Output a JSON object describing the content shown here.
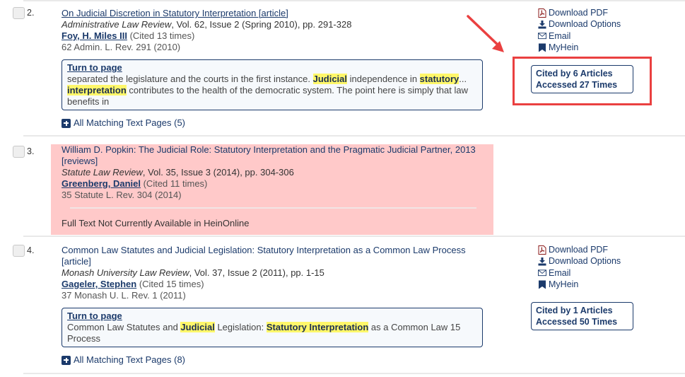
{
  "results": [
    {
      "index": "2.",
      "title": "On Judicial Discretion in Statutory Interpretation [article]",
      "journal_name": "Administrative Law Review",
      "journal_rest": ", Vol. 62, Issue 2 (Spring 2010), pp. 291-328",
      "author": "Foy, H. Miles III",
      "author_cited": " (Cited 13 times)",
      "citation": "62 Admin. L. Rev. 291 (2010)",
      "snippet": {
        "turn_to_page": "Turn to page",
        "parts": [
          {
            "text": "separated the legislature and the courts in the first instance. ",
            "hl": false
          },
          {
            "text": "Judicial",
            "hl": true
          },
          {
            "text": " independence in ",
            "hl": false
          },
          {
            "text": "statutory",
            "hl": true
          },
          {
            "text": "... ",
            "hl": false
          },
          {
            "text": "interpretation",
            "hl": true
          },
          {
            "text": " contributes to the health of the democratic system. The point here is simply that law benefits in",
            "hl": false
          }
        ]
      },
      "all_matching": "All Matching Text Pages (5)",
      "actions": [
        "Download PDF",
        "Download Options",
        "Email",
        "MyHein"
      ],
      "stats": {
        "cited_by": "Cited by 6 Articles",
        "accessed": "Accessed 27 Times"
      }
    },
    {
      "index": "3.",
      "title": "William D. Popkin: The Judicial Role: Statutory Interpretation and the Pragmatic Judicial Partner, 2013 [reviews]",
      "journal_name": "Statute Law Review",
      "journal_rest": ", Vol. 35, Issue 3 (2014), pp. 304-306",
      "author": "Greenberg, Daniel",
      "author_cited": " (Cited 11 times)",
      "citation": "35 Statute L. Rev. 304 (2014)",
      "unavailable": "Full Text Not Currently Available in HeinOnline"
    },
    {
      "index": "4.",
      "title": "Common Law Statutes and Judicial Legislation: Statutory Interpretation as a Common Law Process [article]",
      "journal_name": "Monash University Law Review",
      "journal_rest": ", Vol. 37, Issue 2 (2011), pp. 1-15",
      "author": "Gageler, Stephen",
      "author_cited": " (Cited 15 times)",
      "citation": "37 Monash U. L. Rev. 1 (2011)",
      "snippet": {
        "turn_to_page": "Turn to page",
        "parts": [
          {
            "text": "Common Law Statutes and ",
            "hl": false
          },
          {
            "text": "Judicial",
            "hl": true
          },
          {
            "text": " Legislation: ",
            "hl": false
          },
          {
            "text": "Statutory Interpretation",
            "hl": true
          },
          {
            "text": " as a Common Law 15 Process",
            "hl": false
          }
        ]
      },
      "all_matching": "All Matching Text Pages (8)",
      "actions": [
        "Download PDF",
        "Download Options",
        "Email",
        "MyHein"
      ],
      "stats": {
        "cited_by": "Cited by 1 Articles",
        "accessed": "Accessed 50 Times"
      }
    }
  ],
  "annotation": {
    "color": "#ea4040",
    "target": "citation-stats-result-2"
  },
  "colors": {
    "link": "#1b3a6b",
    "highlight": "#fff76a",
    "unavailable_bg": "#ffc9c9",
    "pdf_icon": "#8b1a1a"
  }
}
